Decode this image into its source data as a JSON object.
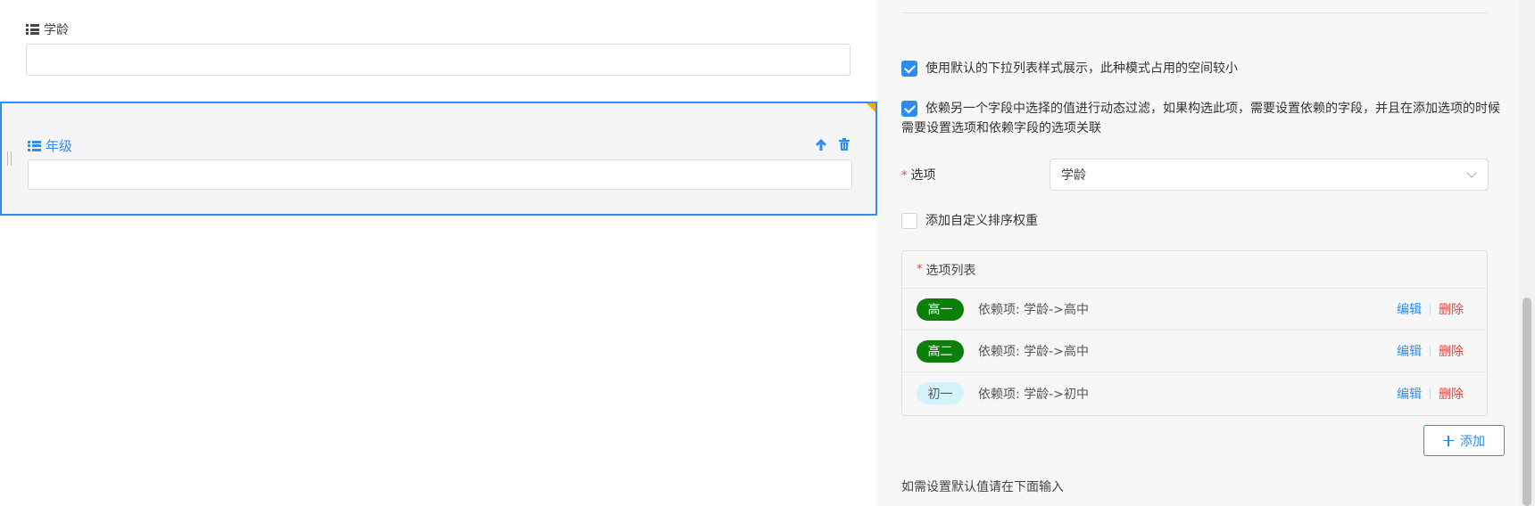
{
  "canvas": {
    "fields": [
      {
        "label": "学龄",
        "value": ""
      },
      {
        "label": "年级",
        "value": "",
        "selected": true
      }
    ]
  },
  "panel": {
    "checkboxes": [
      {
        "checked": true,
        "label": "使用默认的下拉列表样式展示，此种模式占用的空间较小"
      },
      {
        "checked": true,
        "label": "依赖另一个字段中选择的值进行动态过滤，如果构选此项，需要设置依赖的字段，并且在添加选项的时候需要设置选项和依赖字段的选项关联"
      },
      {
        "checked": false,
        "label": "添加自定义排序权重"
      }
    ],
    "options_field": {
      "required_mark": "*",
      "label": "选项",
      "selected_value": "学龄"
    },
    "option_list": {
      "required_mark": "*",
      "title": "选项列表",
      "items": [
        {
          "tag": "高一",
          "dependency": "依赖项: 学龄->高中",
          "edit": "编辑",
          "delete": "删除"
        },
        {
          "tag": "高二",
          "dependency": "依赖项: 学龄->高中",
          "edit": "编辑",
          "delete": "删除"
        },
        {
          "tag": "初一",
          "dependency": "依赖项: 学龄->初中",
          "edit": "编辑",
          "delete": "删除"
        }
      ]
    },
    "add_button": "添加",
    "default_hint": "如需设置默认值请在下面输入"
  },
  "colors": {
    "accent": "#2d8cf0",
    "danger": "#e64340",
    "tag_green": "#0a7f0a",
    "tag_light": "#d5f3fb",
    "corner_marker": "#f5a623"
  },
  "icons": [
    "list-icon",
    "arrow-up-icon",
    "trash-icon",
    "drag-handle-icon",
    "chevron-down-icon",
    "plus-icon",
    "checkbox-checked-icon"
  ]
}
